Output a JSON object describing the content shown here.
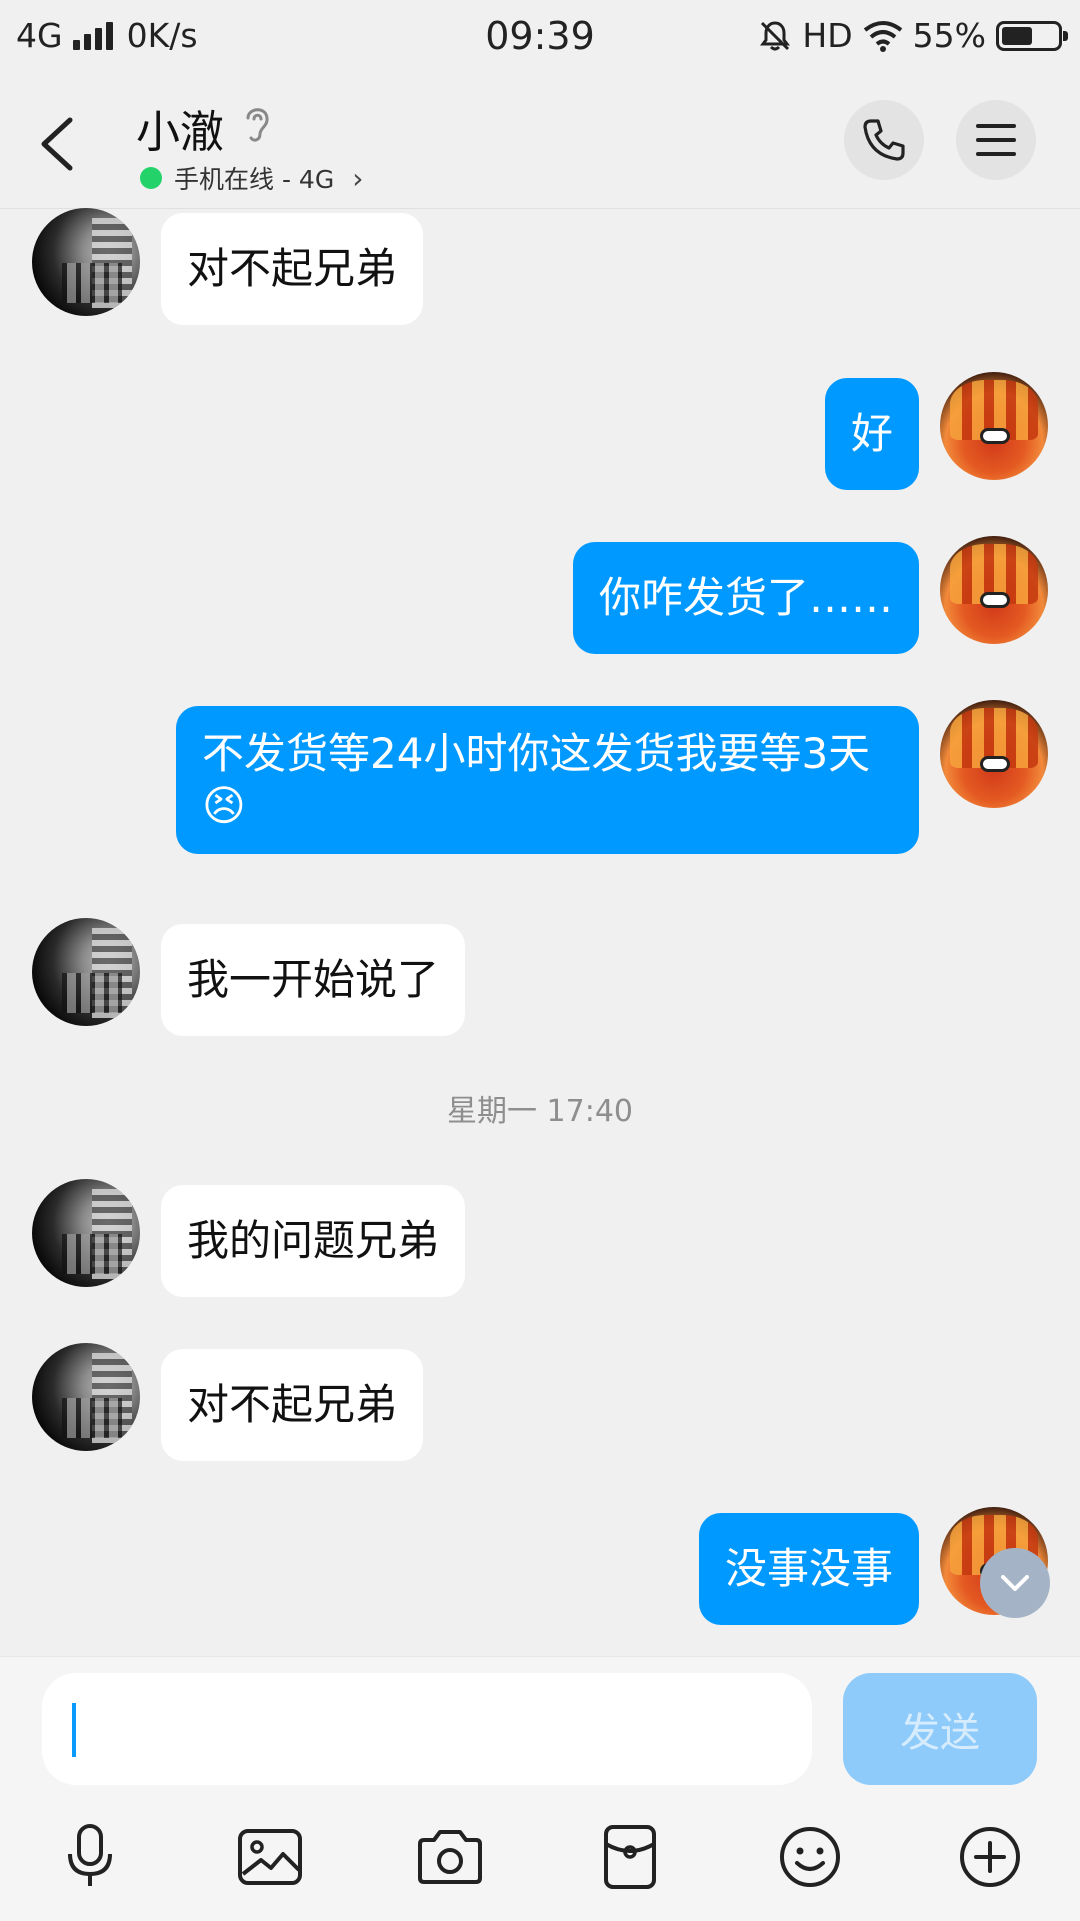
{
  "status_bar": {
    "network": "4G",
    "speed": "0K/s",
    "time": "09:39",
    "hd": "HD",
    "battery_text": "55%",
    "battery_level": 0.55
  },
  "header": {
    "contact_name": "小澈",
    "presence_text": "手机在线 - 4G",
    "presence_color": "#23d36a"
  },
  "messages": [
    {
      "from": "them",
      "text": "对不起兄弟"
    },
    {
      "from": "me",
      "text": "好"
    },
    {
      "from": "me",
      "text": "你咋发货了……"
    },
    {
      "from": "me",
      "text": "不发货等24小时你这发货我要等3天😣"
    },
    {
      "from": "them",
      "text": "我一开始说了"
    },
    {
      "from": "them",
      "text": "我的问题兄弟"
    },
    {
      "from": "them",
      "text": "对不起兄弟"
    },
    {
      "from": "me",
      "text": "没事没事"
    }
  ],
  "timestamp": "星期一 17:40",
  "input": {
    "value": "",
    "send_label": "发送"
  },
  "colors": {
    "my_bubble": "#0099ff",
    "their_bubble": "#ffffff",
    "background": "#f0f0f0",
    "send_disabled": "#8ecbfa"
  },
  "toolbar_icons": [
    "microphone-icon",
    "image-icon",
    "camera-icon",
    "red-packet-icon",
    "emoji-icon",
    "plus-icon"
  ]
}
